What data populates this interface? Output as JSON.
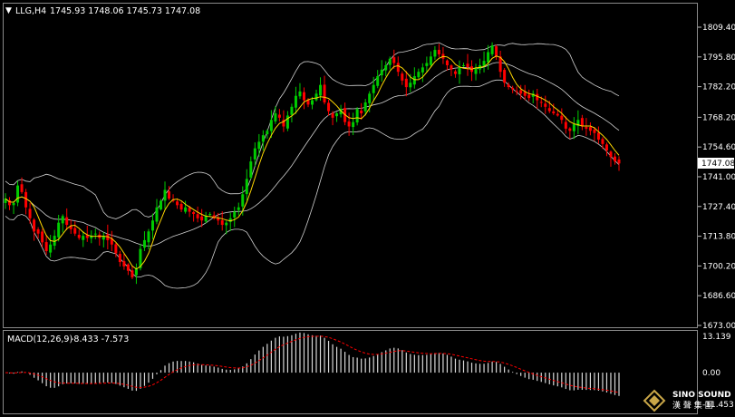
{
  "header": {
    "symbol_timeframe": "LLG,H4",
    "ohlc": "1745.93 1748.06 1745.73 1747.08",
    "dropdown_glyph": "▼"
  },
  "macd_header": {
    "label": "MACD(12,26,9)",
    "values": "-8.433 -7.573"
  },
  "price_axis": {
    "ticks": [
      "1809.40",
      "1795.80",
      "1782.20",
      "1768.20",
      "1754.60",
      "1741.00",
      "1727.40",
      "1713.80",
      "1700.20",
      "1686.60",
      "1673.00"
    ],
    "current_price": "1747.08"
  },
  "macd_axis": {
    "ticks": [
      "13.139",
      "0.00",
      "-11.453"
    ]
  },
  "watermark": {
    "brand": "SINO SOUND",
    "chinese": "漢 聲 集 團"
  },
  "colors": {
    "background": "#000000",
    "bull_candle": "#00cc00",
    "bear_candle": "#ff0000",
    "bollinger": "#d0d0d0",
    "moving_average": "#ffd700",
    "macd_histogram": "#d8d8d8",
    "macd_signal": "#ff0000",
    "axis_text": "#ffffff"
  },
  "chart_data": [
    {
      "type": "candlestick",
      "instrument": "LLG",
      "timeframe": "H4",
      "ylim": [
        1673.0,
        1813.0
      ],
      "indicators": [
        "Bollinger Bands",
        "Moving Average"
      ],
      "close": [
        1731,
        1728,
        1729,
        1737,
        1734,
        1727,
        1722,
        1716,
        1715,
        1711,
        1707,
        1710,
        1714,
        1720,
        1723,
        1719,
        1717,
        1715,
        1713,
        1714,
        1713,
        1714,
        1715,
        1713,
        1714,
        1712,
        1710,
        1706,
        1702,
        1700,
        1698,
        1695,
        1699,
        1708,
        1712,
        1716,
        1721,
        1727,
        1730,
        1735,
        1731,
        1730,
        1728,
        1726,
        1727,
        1725,
        1724,
        1722,
        1721,
        1723,
        1724,
        1722,
        1721,
        1719,
        1720,
        1722,
        1725,
        1727,
        1733,
        1740,
        1748,
        1754,
        1757,
        1760,
        1762,
        1767,
        1770,
        1768,
        1764,
        1769,
        1773,
        1778,
        1780,
        1776,
        1774,
        1776,
        1779,
        1783,
        1775,
        1771,
        1768,
        1770,
        1772,
        1766,
        1764,
        1766,
        1772,
        1770,
        1775,
        1779,
        1783,
        1787,
        1790,
        1792,
        1795,
        1793,
        1789,
        1785,
        1782,
        1784,
        1787,
        1789,
        1791,
        1793,
        1796,
        1799,
        1797,
        1795,
        1792,
        1790,
        1788,
        1791,
        1792,
        1791,
        1789,
        1791,
        1792,
        1794,
        1798,
        1801,
        1796,
        1789,
        1784,
        1782,
        1781,
        1780,
        1779,
        1778,
        1777,
        1779,
        1776,
        1775,
        1773,
        1771,
        1770,
        1769,
        1767,
        1763,
        1762,
        1765,
        1767,
        1764,
        1763,
        1762,
        1761,
        1758,
        1756,
        1753,
        1750,
        1748,
        1747.08
      ]
    },
    {
      "type": "bar",
      "title": "MACD(12,26,9)",
      "main": -8.433,
      "signal": -7.573,
      "ylim": [
        -11.453,
        13.139
      ]
    }
  ]
}
